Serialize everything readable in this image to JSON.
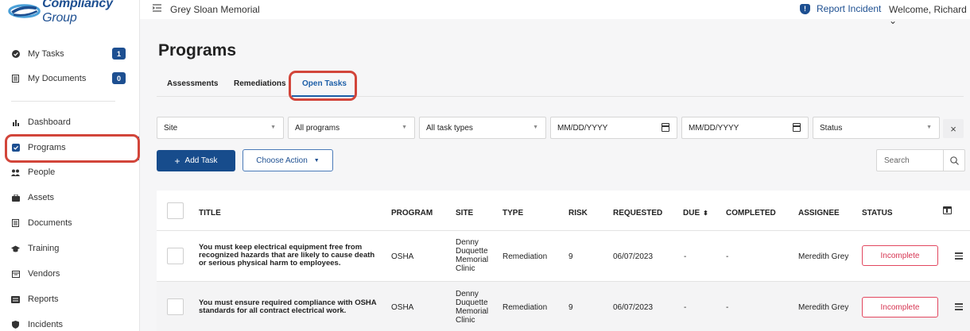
{
  "brand": {
    "name_bold": "Compliancy",
    "name_light": "Group"
  },
  "topbar": {
    "org_name": "Grey Sloan Memorial",
    "report_label": "Report Incident",
    "welcome_label": "Welcome, Richard ⌄"
  },
  "sidebar": {
    "items": [
      {
        "label": "My Tasks",
        "icon": "check-circle-icon",
        "badge": "1"
      },
      {
        "label": "My Documents",
        "icon": "document-icon",
        "badge": "0"
      },
      {
        "label": "Dashboard",
        "icon": "bar-chart-icon"
      },
      {
        "label": "Programs",
        "icon": "checkbox-icon",
        "active": true
      },
      {
        "label": "People",
        "icon": "people-icon"
      },
      {
        "label": "Assets",
        "icon": "briefcase-icon"
      },
      {
        "label": "Documents",
        "icon": "document-icon"
      },
      {
        "label": "Training",
        "icon": "graduation-cap-icon"
      },
      {
        "label": "Vendors",
        "icon": "vendor-icon"
      },
      {
        "label": "Reports",
        "icon": "reports-icon"
      },
      {
        "label": "Incidents",
        "icon": "shield-icon"
      }
    ]
  },
  "page": {
    "title": "Programs",
    "tabs": [
      {
        "label": "Assessments"
      },
      {
        "label": "Remediations"
      },
      {
        "label": "Open Tasks",
        "active": true
      }
    ]
  },
  "filters": {
    "site": "Site",
    "program": "All programs",
    "task_type": "All task types",
    "date_from": "MM/DD/YYYY",
    "date_to": "MM/DD/YYYY",
    "status": "Status",
    "clear": "×"
  },
  "actions": {
    "add_task": "Add Task",
    "choose_action": "Choose Action",
    "search_placeholder": "Search"
  },
  "table": {
    "columns": [
      "TITLE",
      "PROGRAM",
      "SITE",
      "TYPE",
      "RISK",
      "REQUESTED",
      "DUE",
      "COMPLETED",
      "ASSIGNEE",
      "STATUS"
    ],
    "rows": [
      {
        "title": "You must keep electrical equipment free from recognized hazards that are likely to cause death or serious physical harm to employees.",
        "program": "OSHA",
        "site": "Denny Duquette Memorial Clinic",
        "type": "Remediation",
        "risk": "9",
        "requested": "06/07/2023",
        "due": "-",
        "completed": "-",
        "assignee": "Meredith Grey",
        "status": "Incomplete"
      },
      {
        "title": "You must ensure required compliance with OSHA standards for all contract electrical work.",
        "program": "OSHA",
        "site": "Denny Duquette Memorial Clinic",
        "type": "Remediation",
        "risk": "9",
        "requested": "06/07/2023",
        "due": "-",
        "completed": "-",
        "assignee": "Meredith Grey",
        "status": "Incomplete"
      }
    ]
  },
  "colors": {
    "brand_blue": "#1d4f91",
    "accent_blue": "#1d5fa8",
    "highlight_red": "#d2453a",
    "status_red": "#e2475f"
  }
}
